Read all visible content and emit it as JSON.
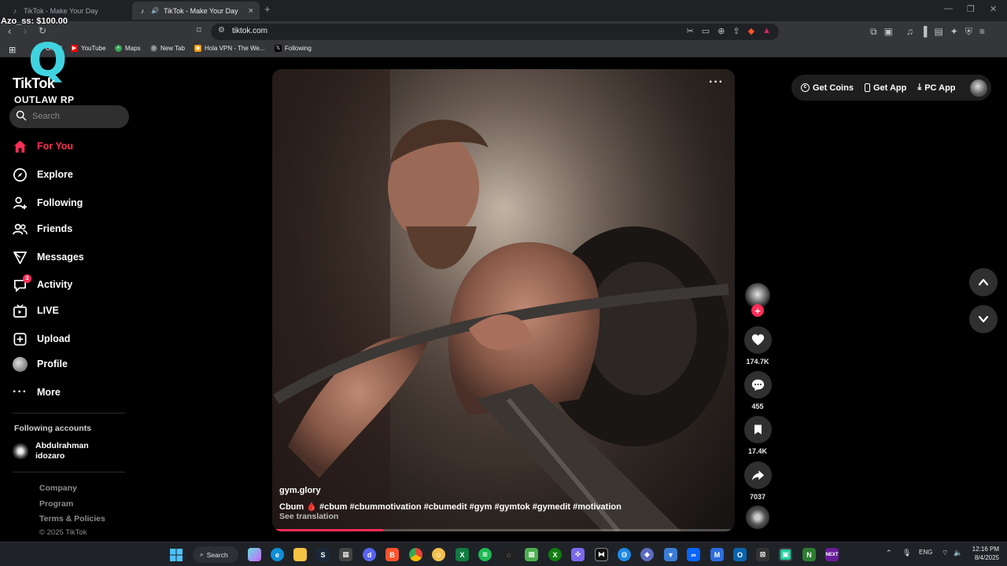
{
  "browser": {
    "tabs": [
      {
        "title": "TikTok - Make Your Day",
        "active": false
      },
      {
        "title": "TikTok - Make Your Day",
        "active": true
      }
    ],
    "url": "tiktok.com",
    "bookmarks": [
      {
        "label": "Gmail",
        "color": "#ea4335"
      },
      {
        "label": "YouTube",
        "color": "#ff0000"
      },
      {
        "label": "Maps",
        "color": "#34a853"
      },
      {
        "label": "New Tab",
        "color": "#5f6368"
      },
      {
        "label": "Hola VPN - The We...",
        "color": "#f29900"
      },
      {
        "label": "Following",
        "color": "#000000"
      }
    ]
  },
  "overlay": {
    "balance": "Azo_ss: $100.00"
  },
  "logo": {
    "glyph": "Q",
    "brand": "TikTok",
    "subtitle": "OUTLAW RP"
  },
  "search": {
    "placeholder": "Search"
  },
  "nav": [
    {
      "label": "For You",
      "icon": "home-icon",
      "active": true
    },
    {
      "label": "Explore",
      "icon": "compass-icon"
    },
    {
      "label": "Following",
      "icon": "user-follow-icon"
    },
    {
      "label": "Friends",
      "icon": "friends-icon"
    },
    {
      "label": "Messages",
      "icon": "send-icon"
    },
    {
      "label": "Activity",
      "icon": "activity-icon",
      "badge": "3"
    },
    {
      "label": "LIVE",
      "icon": "live-icon"
    },
    {
      "label": "Upload",
      "icon": "upload-icon"
    },
    {
      "label": "Profile",
      "icon": "avatar"
    },
    {
      "label": "More",
      "icon": "more-icon"
    }
  ],
  "following_accounts": {
    "heading": "Following accounts",
    "accounts": [
      {
        "name_line1": "Abdulrahman",
        "name_line2": "idozaro"
      }
    ]
  },
  "footer": {
    "company": "Company",
    "program": "Program",
    "terms": "Terms & Policies",
    "copyright": "© 2025 TikTok"
  },
  "video": {
    "author": "gym.glory",
    "caption": "Cbum 🩸 #cbum #cbummotivation #cbumedit #gym #gymtok #gymedit #motivation",
    "see_translation": "See translation",
    "progress": 0.24
  },
  "actions": {
    "likes": "174.7K",
    "comments": "455",
    "saves": "17.4K",
    "shares": "7037"
  },
  "topright": {
    "get_coins": "Get Coins",
    "get_app": "Get App",
    "pc_app": "PC App"
  },
  "taskbar": {
    "search": "Search",
    "lang": "ENG",
    "time": "12:16 PM",
    "date": "8/4/2025"
  },
  "colors": {
    "accent": "#fe2c55",
    "logo_teal": "#3fd3e0"
  }
}
